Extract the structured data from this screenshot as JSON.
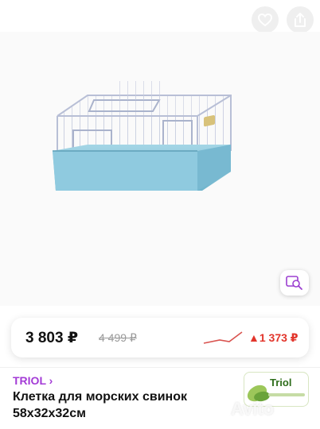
{
  "header": {
    "back_icon": "chevron-left-icon",
    "favorite_icon": "heart-icon",
    "share_icon": "share-icon"
  },
  "gallery": {
    "image_subject": "wire cage with blue plastic tray",
    "lens_icon": "image-search-icon"
  },
  "price": {
    "current": "3 803 ₽",
    "old": "4 499 ₽",
    "change": "▲1 373 ₽",
    "change_color": "#e2352b",
    "trend_icon": "price-trend-icon"
  },
  "product": {
    "brand": "TRIOL ›",
    "brand_color": "#a33bd6",
    "title": "Клетка для морских свинок 58x32x32см",
    "logo_text": "Triol"
  },
  "watermark": "Avito"
}
